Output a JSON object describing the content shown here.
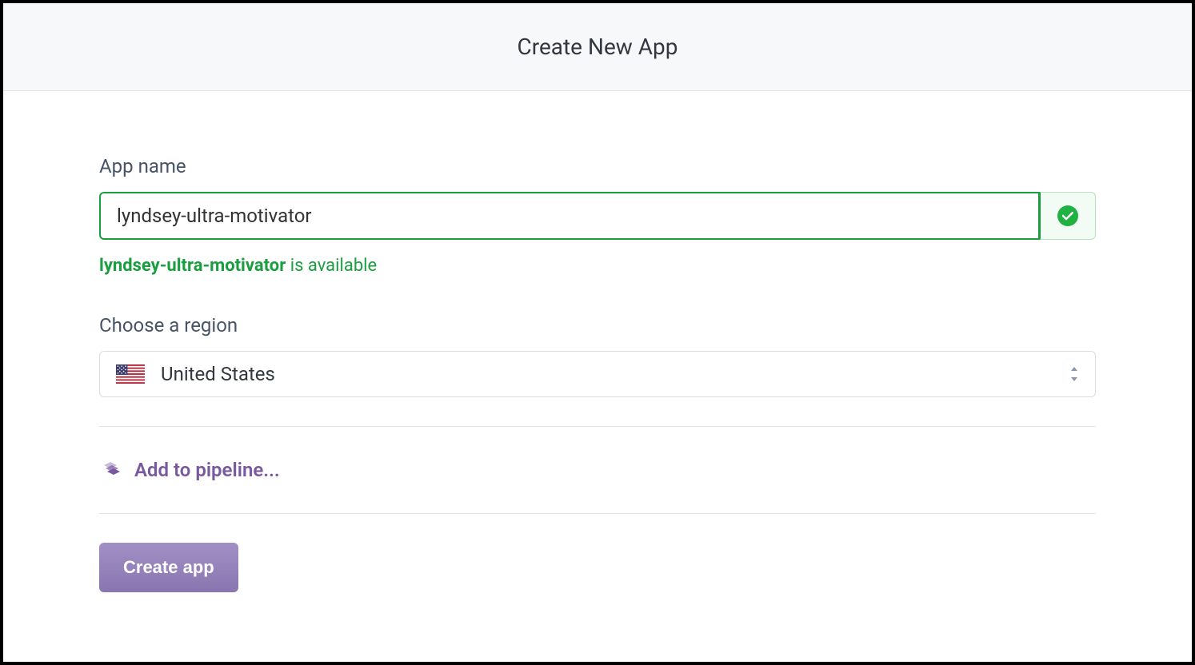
{
  "header": {
    "title": "Create New App"
  },
  "form": {
    "appNameLabel": "App name",
    "appNameValue": "lyndsey-ultra-motivator",
    "availabilityName": "lyndsey-ultra-motivator",
    "availabilityStatus": " is available",
    "regionLabel": "Choose a region",
    "regionSelected": "United States",
    "pipelineText": "Add to pipeline...",
    "createButtonLabel": "Create app"
  }
}
